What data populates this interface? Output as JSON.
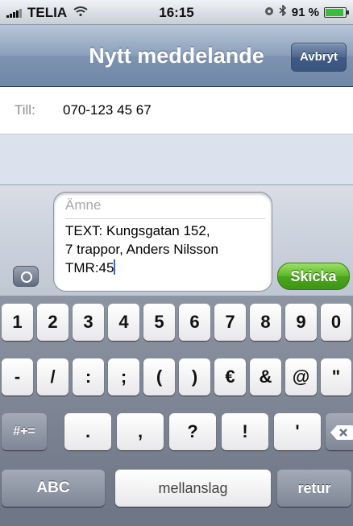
{
  "status_bar": {
    "carrier": "TELIA",
    "time": "16:15",
    "battery": "91 %",
    "battery_level": 0.91,
    "icons": [
      "signal-icon",
      "wifi-icon",
      "lock-icon",
      "bluetooth-icon",
      "battery-icon"
    ]
  },
  "nav": {
    "title": "Nytt meddelande",
    "cancel_label": "Avbryt"
  },
  "recipient": {
    "label": "Till:",
    "value": "070-123 45 67"
  },
  "compose": {
    "subject_placeholder": "Ämne",
    "body": "TEXT: Kungsgatan 152,\n7 trappor, Anders Nilsson\nTMR:45",
    "send_label": "Skicka",
    "camera_icon": "camera-icon"
  },
  "keyboard": {
    "row1": [
      "1",
      "2",
      "3",
      "4",
      "5",
      "6",
      "7",
      "8",
      "9",
      "0"
    ],
    "row2": [
      "-",
      "/",
      ":",
      ";",
      "(",
      ")",
      "€",
      "&",
      "@",
      "\""
    ],
    "row3": {
      "toggle": "#+=",
      "keys": [
        ".",
        ",",
        "?",
        "!",
        "'"
      ],
      "delete_icon": "backspace-icon"
    },
    "row4": {
      "abc": "ABC",
      "space": "mellanslag",
      "return": "retur"
    }
  },
  "colors": {
    "nav_blue": "#6f87a8",
    "send_green": "#4aa51b",
    "keyboard_bg": "#6d7585"
  }
}
